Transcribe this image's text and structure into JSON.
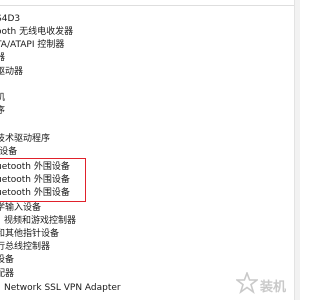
{
  "tree": {
    "rows": [
      {
        "label": "S4D3"
      },
      {
        "label": "ooth 无线电收发器"
      },
      {
        "label": "TA/ATAPI 控制器"
      },
      {
        "label": "器"
      },
      {
        "label": "驱动器"
      },
      {
        "label": ""
      },
      {
        "label": "机"
      },
      {
        "label": "序"
      },
      {
        "label": ""
      },
      {
        "label": "技术驱动程序"
      },
      {
        "label": "-设备"
      },
      {
        "label": "uetooth 外围设备"
      },
      {
        "label": "uetooth 外围设备"
      },
      {
        "label": "uetooth 外围设备"
      },
      {
        "label": "学输入设备"
      },
      {
        "label": "视频和游戏控制器"
      },
      {
        "label": "和其他指针设备"
      },
      {
        "label": "行总线控制器"
      },
      {
        "label": "设备"
      },
      {
        "label": "配器"
      },
      {
        "label": "Network SSL VPN Adapter"
      }
    ]
  },
  "watermark": {
    "text": "装机"
  }
}
